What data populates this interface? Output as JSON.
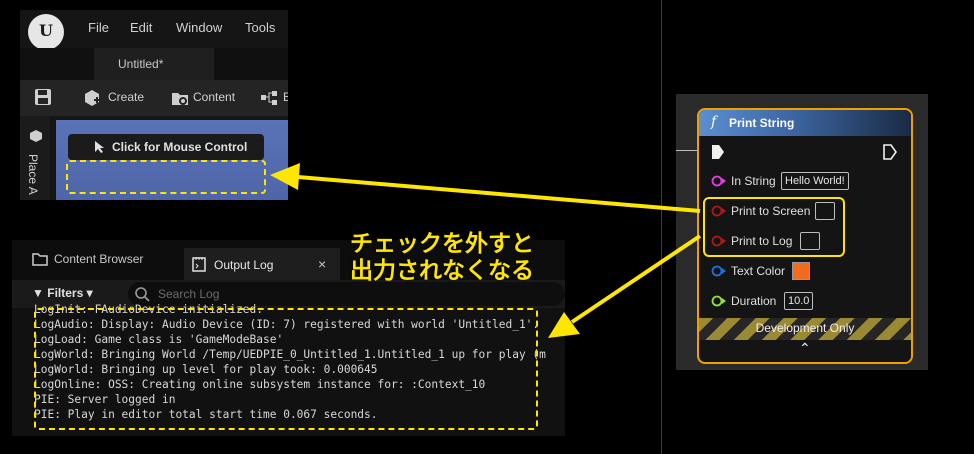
{
  "editor": {
    "menu": [
      "File",
      "Edit",
      "Window",
      "Tools"
    ],
    "logo_text": "U",
    "document_tab": "Untitled*",
    "toolbar": {
      "create": "Create",
      "content": "Content",
      "more": "B"
    },
    "side_label": "Place A",
    "click_mouse_control": "Click for Mouse Control"
  },
  "log_panel": {
    "tab_content_browser": "Content Browser",
    "tab_output_log": "Output Log",
    "tab_close": "×",
    "filters": "Filters",
    "search_placeholder": "Search Log",
    "lines": [
      "LogInit: FAudioDevice initialized.",
      "LogAudio: Display: Audio Device (ID: 7) registered with world 'Untitled_1'.",
      "LogLoad: Game class is 'GameModeBase'",
      "LogWorld: Bringing World /Temp/UEDPIE_0_Untitled_1.Untitled_1 up for play (m",
      "LogWorld: Bringing up level for play took: 0.000645",
      "LogOnline: OSS: Creating online subsystem instance for: :Context_10",
      "PIE: Server logged in",
      "PIE: Play in editor total start time 0.067 seconds."
    ]
  },
  "node": {
    "title": "Print String",
    "func_symbol": "f",
    "in_string_label": "In String",
    "in_string_value": "Hello World!",
    "print_to_screen_label": "Print to Screen",
    "print_to_log_label": "Print to Log",
    "print_to_screen_checked": false,
    "print_to_log_checked": false,
    "text_color_label": "Text Color",
    "text_color": "#f26a1b",
    "duration_label": "Duration",
    "duration_value": "10.0",
    "development_only": "Development Only",
    "collapse_arrow": "⌃"
  },
  "callout": {
    "line1": "チェックを外すと",
    "line2": "出力されなくなる"
  },
  "colors": {
    "highlight": "#ffe600",
    "node_border": "#f0a000",
    "pin_magenta": "#e040e0",
    "pin_red": "#b01818",
    "pin_blue": "#2070e0",
    "pin_green": "#90e040"
  }
}
